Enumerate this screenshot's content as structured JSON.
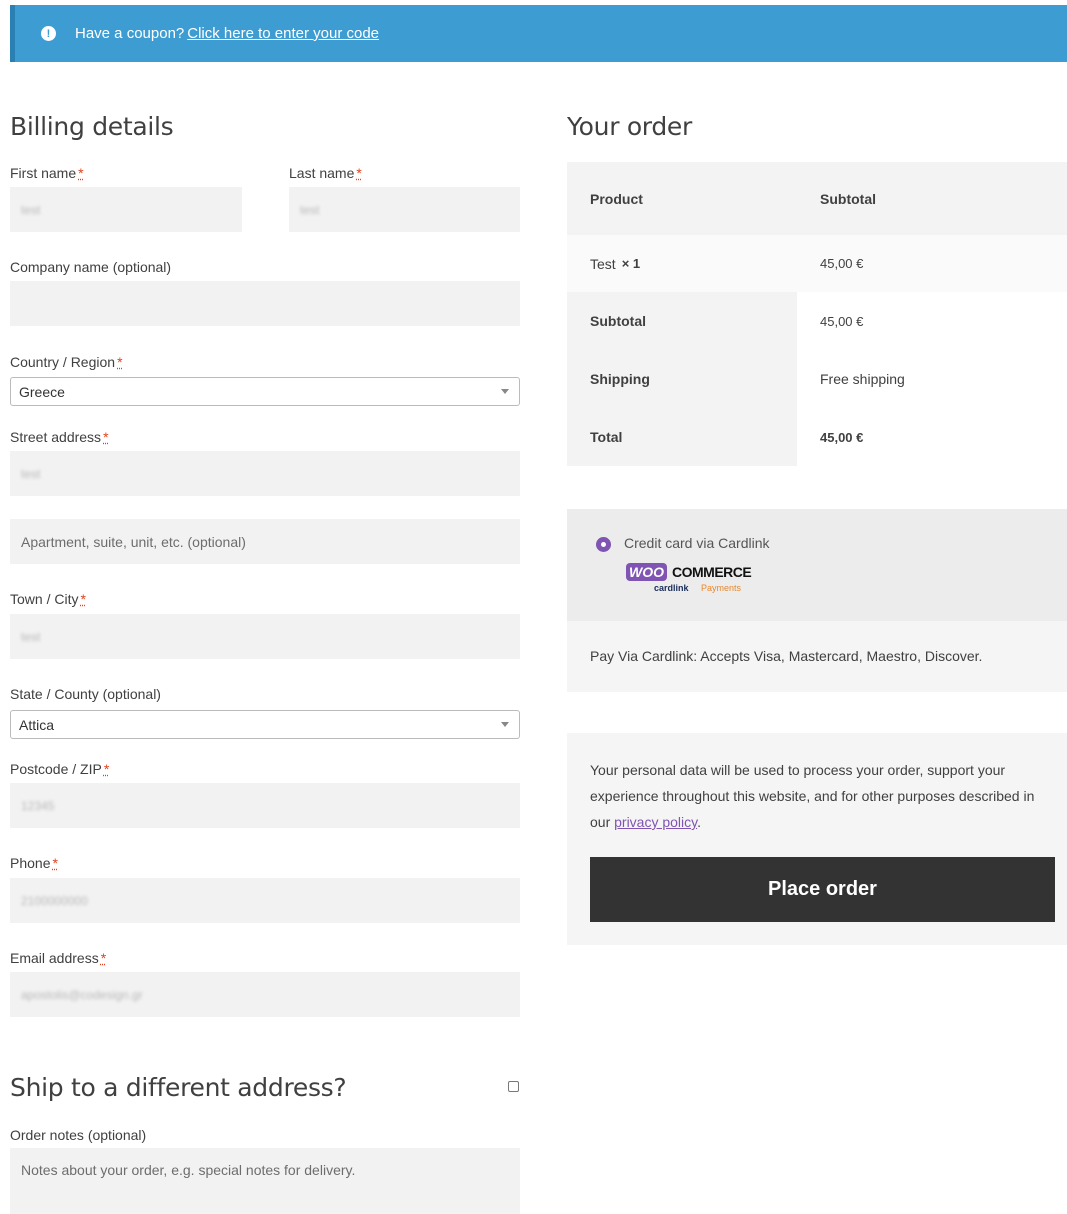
{
  "coupon": {
    "text": "Have a coupon?",
    "link": "Click here to enter your code"
  },
  "billing": {
    "title": "Billing details",
    "first_name_label": "First name",
    "first_name_value": "test",
    "last_name_label": "Last name",
    "last_name_value": "test",
    "company_label": "Company name (optional)",
    "country_label": "Country / Region",
    "country_value": "Greece",
    "street_label": "Street address",
    "street_value": "test",
    "apartment_placeholder": "Apartment, suite, unit, etc. (optional)",
    "town_label": "Town / City",
    "town_value": "test",
    "state_label": "State / County (optional)",
    "state_value": "Attica",
    "postcode_label": "Postcode / ZIP",
    "postcode_value": "12345",
    "phone_label": "Phone",
    "phone_value": "2100000000",
    "email_label": "Email address",
    "email_value": "apostolis@codesign.gr",
    "required_mark": "*"
  },
  "shipping": {
    "title": "Ship to a different address?",
    "notes_label": "Order notes (optional)",
    "notes_placeholder": "Notes about your order, e.g. special notes for delivery."
  },
  "order": {
    "title": "Your order",
    "header_product": "Product",
    "header_subtotal": "Subtotal",
    "item_name": "Test",
    "item_qty": "× 1",
    "item_price": "45,00 €",
    "subtotal_label": "Subtotal",
    "subtotal_value": "45,00 €",
    "shipping_label": "Shipping",
    "shipping_value": "Free shipping",
    "total_label": "Total",
    "total_value": "45,00 €"
  },
  "payment": {
    "method_label": "Credit card via Cardlink",
    "logo_woo": "WOO",
    "logo_commerce": "COMMERCE",
    "logo_cardlink": "cardlink",
    "logo_payments": "Payments",
    "description": "Pay Via Cardlink: Accepts Visa, Mastercard, Maestro, Discover."
  },
  "privacy": {
    "text": "Your personal data will be used to process your order, support your experience throughout this website, and for other purposes described in our",
    "link": "privacy policy",
    "button": "Place order"
  },
  "colors": {
    "notice_blue": "#3d9cd2",
    "button_dark": "#333333",
    "radio_purple": "#7f54b3",
    "required_red": "#e2401c"
  }
}
